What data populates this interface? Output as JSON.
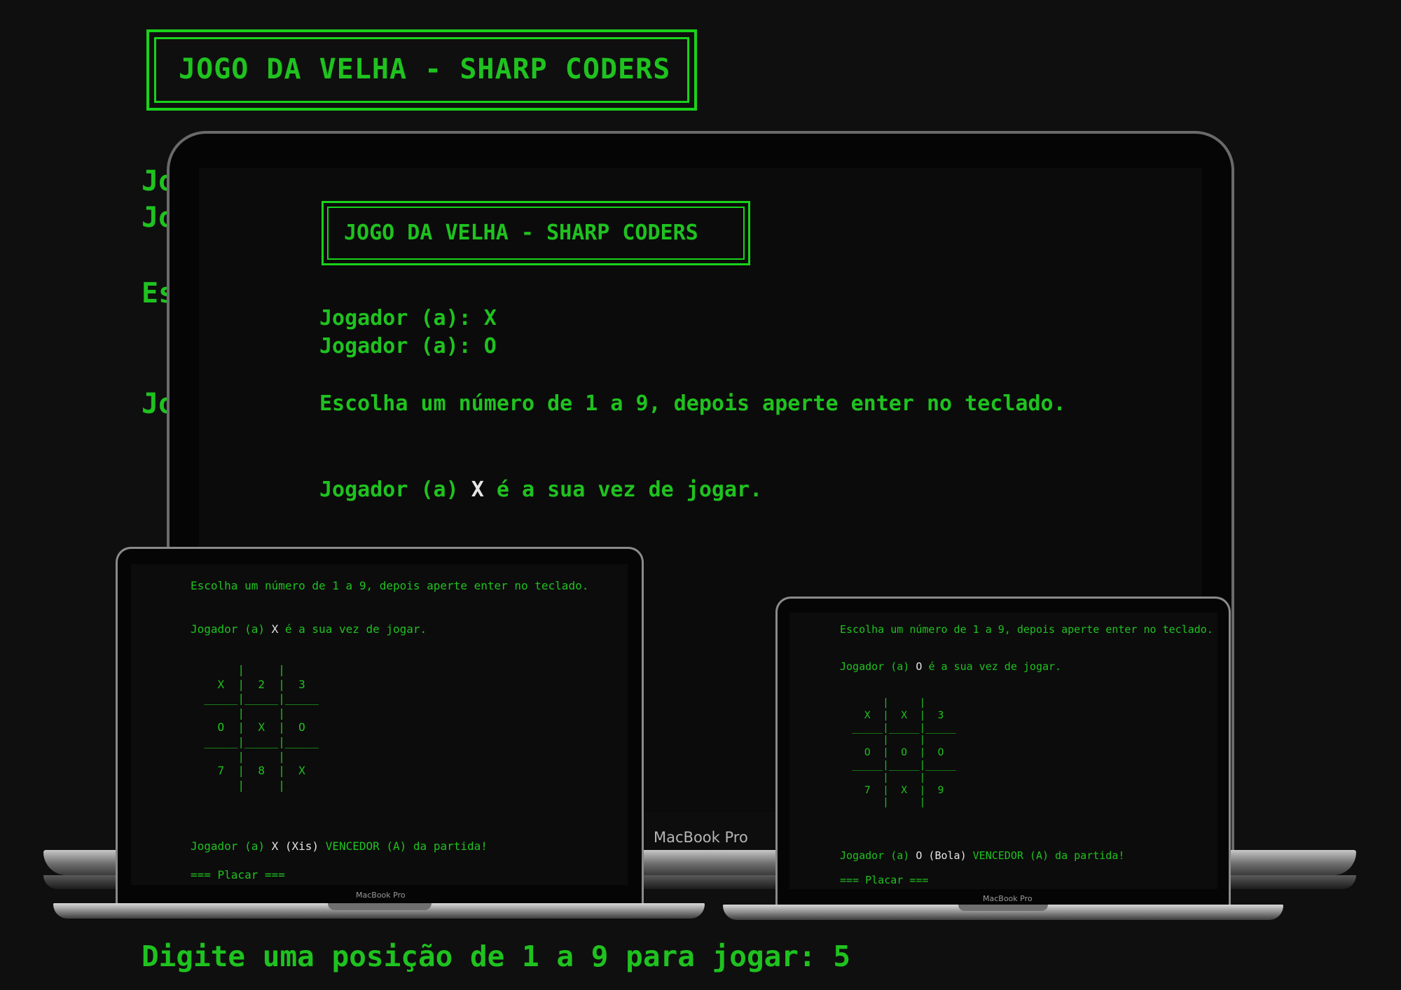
{
  "background_terminal": {
    "title": "JOGO DA VELHA - SHARP CODERS",
    "line1": "Jo",
    "line2": "Jo",
    "line3": "Es",
    "line4": "Jo",
    "prompt": "Digite uma posição de 1 a 9 para jogar: 5"
  },
  "big_laptop": {
    "brand": "MacBook Pro",
    "title": "JOGO DA VELHA - SHARP CODERS",
    "player1": "Jogador (a): X",
    "player2": "Jogador (a): O",
    "instruction": "Escolha um número de 1 a 9, depois aperte enter no teclado.",
    "turn_prefix": "Jogador (a)",
    "turn_player": "X",
    "turn_suffix": "é a sua vez de jogar."
  },
  "left_laptop": {
    "brand": "MacBook Pro",
    "instruction": "Escolha um número de 1 a 9, depois aperte enter no teclado.",
    "turn_prefix": "Jogador (a)",
    "turn_player": "X",
    "turn_suffix": "é a sua vez de jogar.",
    "board": "       |     |\n    X  |  2  |  3\n  _____|_____|_____\n       |     |\n    O  |  X  |  O\n  _____|_____|_____\n       |     |\n    7  |  8  |  X\n       |     |",
    "winner_prefix": "Jogador (a)",
    "winner_player": "X (Xis)",
    "winner_suffix": "VENCEDOR (A) da partida!",
    "score_header": "=== Placar ==="
  },
  "right_laptop": {
    "brand": "MacBook Pro",
    "instruction": "Escolha um número de 1 a 9, depois aperte enter no teclado.",
    "turn_prefix": "Jogador (a)",
    "turn_player": "O",
    "turn_suffix": "é a sua vez de jogar.",
    "board": "       |     |\n    X  |  X  |  3\n  _____|_____|_____\n       |     |\n    O  |  O  |  O\n  _____|_____|_____\n       |     |\n    7  |  X  |  9\n       |     |",
    "winner_prefix": "Jogador (a)",
    "winner_player": "O (Bola)",
    "winner_suffix": "VENCEDOR (A) da partida!",
    "score_header": "=== Placar ==="
  },
  "colors": {
    "background": "#0f0f0f",
    "terminal_green": "#1fc21f",
    "highlight_white": "#e6e6e6"
  }
}
